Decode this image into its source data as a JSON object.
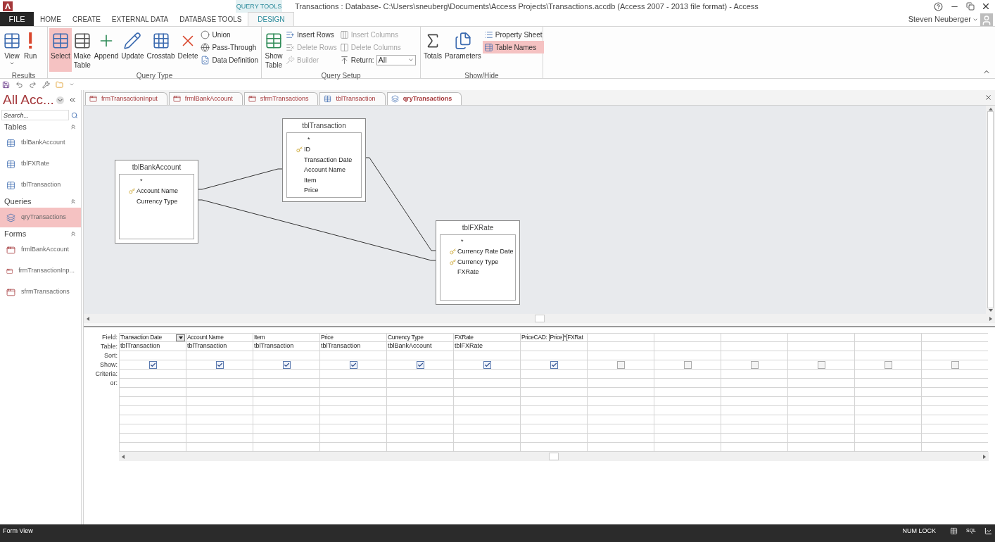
{
  "app": {
    "query_tools_label": "QUERY TOOLS",
    "title": "Transactions : Database- C:\\Users\\sneuberg\\Documents\\Access Projects\\Transactions.accdb (Access 2007 - 2013 file format) - Access",
    "user": "Steven Neuberger"
  },
  "ribbon_tabs": [
    {
      "label": "FILE",
      "kind": "file",
      "selected": false
    },
    {
      "label": "HOME",
      "kind": "tab",
      "selected": false
    },
    {
      "label": "CREATE",
      "kind": "tab",
      "selected": false
    },
    {
      "label": "EXTERNAL DATA",
      "kind": "tab",
      "selected": false
    },
    {
      "label": "DATABASE TOOLS",
      "kind": "tab",
      "selected": false
    },
    {
      "label": "DESIGN",
      "kind": "tab",
      "selected": true
    }
  ],
  "ribbon_groups": [
    {
      "label": "Results",
      "buttons": [
        {
          "kind": "large",
          "label": "View",
          "selected": false,
          "disabled": false
        },
        {
          "kind": "large",
          "label": "Run",
          "selected": false,
          "disabled": false
        }
      ]
    },
    {
      "label": "Query Type",
      "buttons": [
        {
          "kind": "large",
          "label": "Select",
          "selected": true,
          "disabled": false
        },
        {
          "kind": "large",
          "label": "Make Table",
          "selected": false,
          "disabled": false
        },
        {
          "kind": "large",
          "label": "Append",
          "selected": false,
          "disabled": false
        },
        {
          "kind": "large",
          "label": "Update",
          "selected": false,
          "disabled": false
        },
        {
          "kind": "large",
          "label": "Crosstab",
          "selected": false,
          "disabled": false
        },
        {
          "kind": "large",
          "label": "Delete",
          "selected": false,
          "disabled": false
        },
        {
          "kind": "small",
          "label": "Union",
          "selected": false,
          "disabled": false
        },
        {
          "kind": "small",
          "label": "Pass-Through",
          "selected": false,
          "disabled": false
        },
        {
          "kind": "small",
          "label": "Data Definition",
          "selected": false,
          "disabled": false
        }
      ]
    },
    {
      "label": "Query Setup",
      "buttons": [
        {
          "kind": "large",
          "label": "Show Table",
          "selected": false,
          "disabled": false
        },
        {
          "kind": "small",
          "label": "Insert Rows",
          "selected": false,
          "disabled": false
        },
        {
          "kind": "small",
          "label": "Delete Rows",
          "selected": false,
          "disabled": true
        },
        {
          "kind": "small",
          "label": "Builder",
          "selected": false,
          "disabled": true
        },
        {
          "kind": "small",
          "label": "Insert Columns",
          "selected": false,
          "disabled": true
        },
        {
          "kind": "small",
          "label": "Delete Columns",
          "selected": false,
          "disabled": true
        },
        {
          "kind": "dropdown",
          "label": "Return:",
          "value": "All",
          "selected": false,
          "disabled": false
        }
      ]
    },
    {
      "label": "Show/Hide",
      "buttons": [
        {
          "kind": "large",
          "label": "Totals",
          "selected": false,
          "disabled": false
        },
        {
          "kind": "large",
          "label": "Parameters",
          "selected": false,
          "disabled": false
        },
        {
          "kind": "small",
          "label": "Property Sheet",
          "selected": false,
          "disabled": false
        },
        {
          "kind": "small",
          "label": "Table Names",
          "selected": true,
          "disabled": false
        }
      ]
    }
  ],
  "navigation_pane": {
    "title": "All Acc...",
    "search_placeholder": "Search...",
    "groups": [
      {
        "label": "Tables",
        "kind": "table",
        "items": [
          {
            "label": "tblBankAccount",
            "selected": false
          },
          {
            "label": "tblFXRate",
            "selected": false
          },
          {
            "label": "tblTransaction",
            "selected": false
          }
        ]
      },
      {
        "label": "Queries",
        "kind": "query",
        "items": [
          {
            "label": "qryTransactions",
            "selected": true
          }
        ]
      },
      {
        "label": "Forms",
        "kind": "form",
        "items": [
          {
            "label": "frmlBankAccount",
            "selected": false
          },
          {
            "label": "frmTransactionInp...",
            "selected": false
          },
          {
            "label": "sfrmTransactions",
            "selected": false
          }
        ]
      }
    ]
  },
  "document_tabs": [
    {
      "label": "frmTransactionInput",
      "kind": "form",
      "selected": false
    },
    {
      "label": "frmlBankAccount",
      "kind": "form",
      "selected": false
    },
    {
      "label": "sfrmTransactions",
      "kind": "form",
      "selected": false
    },
    {
      "label": "tblTransaction",
      "kind": "table",
      "selected": false
    },
    {
      "label": "qryTransactions",
      "kind": "query",
      "selected": true
    }
  ],
  "diagram_tables": [
    {
      "name": "tblBankAccount",
      "fields": [
        {
          "name": "*",
          "key": false
        },
        {
          "name": "Account Name",
          "key": true
        },
        {
          "name": "Currency Type",
          "key": false
        }
      ]
    },
    {
      "name": "tblTransaction",
      "fields": [
        {
          "name": "*",
          "key": false
        },
        {
          "name": "ID",
          "key": true
        },
        {
          "name": "Transaction Date",
          "key": false
        },
        {
          "name": "Account Name",
          "key": false
        },
        {
          "name": "Item",
          "key": false
        },
        {
          "name": "Price",
          "key": false
        }
      ]
    },
    {
      "name": "tblFXRate",
      "fields": [
        {
          "name": "*",
          "key": false
        },
        {
          "name": "Currency Rate Date",
          "key": true
        },
        {
          "name": "Currency Type",
          "key": true
        },
        {
          "name": "FXRate",
          "key": false
        }
      ]
    }
  ],
  "query_grid": {
    "row_labels": [
      "Field:",
      "Table:",
      "Sort:",
      "Show:",
      "Criteria:",
      "or:"
    ],
    "columns": [
      {
        "field": "Transaction Date",
        "table": "tblTransaction",
        "show": true,
        "selected": true
      },
      {
        "field": "Account Name",
        "table": "tblTransaction",
        "show": true,
        "selected": false
      },
      {
        "field": "Item",
        "table": "tblTransaction",
        "show": true,
        "selected": false
      },
      {
        "field": "Price",
        "table": "tblTransaction",
        "show": true,
        "selected": false
      },
      {
        "field": "Currency Type",
        "table": "tblBankAccount",
        "show": true,
        "selected": false
      },
      {
        "field": "FXRate",
        "table": "tblFXRate",
        "show": true,
        "selected": false
      },
      {
        "field": "PriceCAD: [Price]*[FXRat",
        "show": true,
        "selected": false
      },
      {
        "show": false,
        "selected": false
      },
      {
        "show": false,
        "selected": false
      },
      {
        "show": false,
        "selected": false
      },
      {
        "show": false,
        "selected": false
      },
      {
        "show": false,
        "selected": false
      },
      {
        "show": false,
        "selected": false
      }
    ]
  },
  "status_bar": {
    "view": "Form View",
    "num_lock": "NUM LOCK",
    "sql": "SQL"
  }
}
